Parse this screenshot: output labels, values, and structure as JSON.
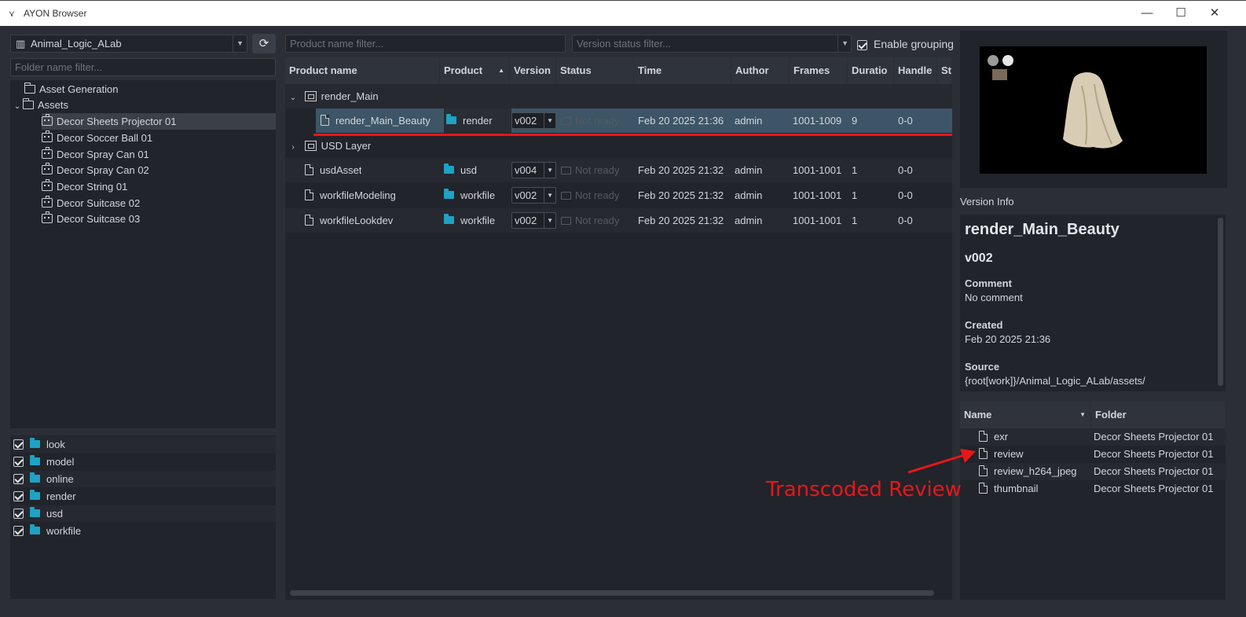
{
  "window": {
    "title": "AYON Browser"
  },
  "project": {
    "name": "Animal_Logic_ALab"
  },
  "folder_filter": {
    "placeholder": "Folder name filter..."
  },
  "folders": [
    {
      "label": "Asset Generation"
    },
    {
      "label": "Assets"
    }
  ],
  "assets": [
    {
      "label": "Decor Sheets Projector 01"
    },
    {
      "label": "Decor Soccer Ball 01"
    },
    {
      "label": "Decor Spray Can 01"
    },
    {
      "label": "Decor Spray Can 02"
    },
    {
      "label": "Decor String 01"
    },
    {
      "label": "Decor Suitcase 02"
    },
    {
      "label": "Decor Suitcase 03"
    }
  ],
  "product_types": [
    {
      "label": "look"
    },
    {
      "label": "model"
    },
    {
      "label": "online"
    },
    {
      "label": "render"
    },
    {
      "label": "usd"
    },
    {
      "label": "workfile"
    }
  ],
  "filters": {
    "product_placeholder": "Product name filter...",
    "status_placeholder": "Version status filter...",
    "grouping_label": "Enable grouping"
  },
  "columns": [
    "Product name",
    "Product",
    "Version",
    "Status",
    "Time",
    "Author",
    "Frames",
    "Duratio",
    "Handle",
    "St"
  ],
  "groups": [
    {
      "label": "render_Main"
    },
    {
      "label": "USD Layer"
    }
  ],
  "products": [
    {
      "name": "render_Main_Beauty",
      "type": "render",
      "version": "v002",
      "status": "Not ready",
      "time": "Feb 20 2025 21:36",
      "author": "admin",
      "frames": "1001-1009",
      "duration": "9",
      "handles": "0-0"
    },
    {
      "name": "usdAsset",
      "type": "usd",
      "version": "v004",
      "status": "Not ready",
      "time": "Feb 20 2025 21:32",
      "author": "admin",
      "frames": "1001-1001",
      "duration": "1",
      "handles": "0-0"
    },
    {
      "name": "workfileModeling",
      "type": "workfile",
      "version": "v002",
      "status": "Not ready",
      "time": "Feb 20 2025 21:32",
      "author": "admin",
      "frames": "1001-1001",
      "duration": "1",
      "handles": "0-0"
    },
    {
      "name": "workfileLookdev",
      "type": "workfile",
      "version": "v002",
      "status": "Not ready",
      "time": "Feb 20 2025 21:32",
      "author": "admin",
      "frames": "1001-1001",
      "duration": "1",
      "handles": "0-0"
    }
  ],
  "version_info": {
    "heading": "Version Info",
    "product": "render_Main_Beauty",
    "version": "v002",
    "comment_label": "Comment",
    "comment": "No comment",
    "created_label": "Created",
    "created": "Feb 20 2025 21:36",
    "source_label": "Source",
    "source": "{root[work]}/Animal_Logic_ALab/assets/"
  },
  "representations": {
    "columns": [
      "Name",
      "Folder"
    ],
    "rows": [
      {
        "name": "exr",
        "folder": "Decor Sheets Projector 01"
      },
      {
        "name": "review",
        "folder": "Decor Sheets Projector 01"
      },
      {
        "name": "review_h264_jpeg",
        "folder": "Decor Sheets Projector 01"
      },
      {
        "name": "thumbnail",
        "folder": "Decor Sheets Projector 01"
      }
    ]
  },
  "annotation": {
    "text": "Transcoded Review",
    "color": "#e8161b"
  },
  "colors": {
    "accent": "#1fa2c4",
    "selection": "#3d5566",
    "annotation": "#e8161b"
  }
}
